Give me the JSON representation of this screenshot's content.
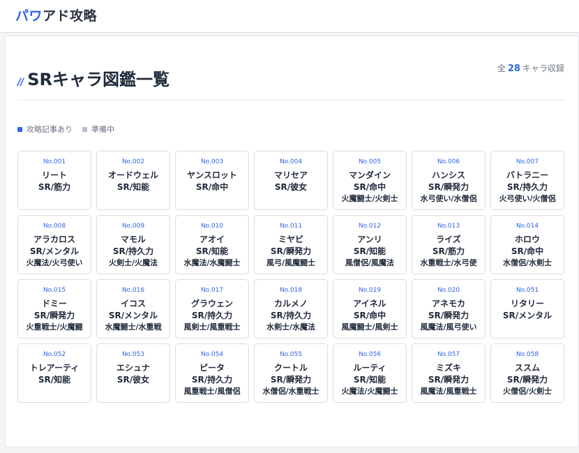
{
  "header": {
    "logo_accent": "パワ",
    "logo_rest": "アド攻略"
  },
  "page": {
    "title_slashes": "//",
    "title": "SRキャラ図鑑一覧",
    "count_prefix": "全",
    "count_value": "28",
    "count_suffix": "キャラ収録"
  },
  "legend": [
    {
      "label": "攻略記事あり",
      "color": "#2f63e8"
    },
    {
      "label": "準備中",
      "color": "#b9c0ca"
    }
  ],
  "cards": [
    {
      "no": "No.001",
      "name": "リート",
      "type": "SR/筋力",
      "job": ""
    },
    {
      "no": "No.002",
      "name": "オードウェル",
      "type": "SR/知能",
      "job": ""
    },
    {
      "no": "No.003",
      "name": "ヤンスロット",
      "type": "SR/命中",
      "job": ""
    },
    {
      "no": "No.004",
      "name": "マリセア",
      "type": "SR/彼女",
      "job": ""
    },
    {
      "no": "No.005",
      "name": "マンダイン",
      "type": "SR/命中",
      "job": "火魔闘士/火剣士"
    },
    {
      "no": "No.006",
      "name": "ハンシス",
      "type": "SR/瞬発力",
      "job": "水弓使い/水僧侶"
    },
    {
      "no": "No.007",
      "name": "バトラニー",
      "type": "SR/持久力",
      "job": "火弓使い/火僧侶"
    },
    {
      "no": "No.008",
      "name": "アラカロス",
      "type": "SR/メンタル",
      "job": "火魔法/火弓使い"
    },
    {
      "no": "No.009",
      "name": "マモル",
      "type": "SR/持久力",
      "job": "火剣士/火魔法"
    },
    {
      "no": "No.010",
      "name": "アオイ",
      "type": "SR/知能",
      "job": "水魔法/水魔闘士"
    },
    {
      "no": "No.011",
      "name": "ミヤビ",
      "type": "SR/瞬発力",
      "job": "風弓/風魔闘士"
    },
    {
      "no": "No.012",
      "name": "アンリ",
      "type": "SR/知能",
      "job": "風僧侶/風魔法"
    },
    {
      "no": "No.013",
      "name": "ライズ",
      "type": "SR/筋力",
      "job": "水重戦士/水弓使"
    },
    {
      "no": "No.014",
      "name": "ホロウ",
      "type": "SR/命中",
      "job": "水僧侶/水剣士"
    },
    {
      "no": "No.015",
      "name": "ドミー",
      "type": "SR/瞬発力",
      "job": "火重戦士/火魔闘"
    },
    {
      "no": "No.016",
      "name": "イコス",
      "type": "SR/メンタル",
      "job": "水魔闘士/水重戦"
    },
    {
      "no": "No.017",
      "name": "グラウェン",
      "type": "SR/持久力",
      "job": "風剣士/風重戦士"
    },
    {
      "no": "No.018",
      "name": "カルメノ",
      "type": "SR/持久力",
      "job": "水剣士/水魔法"
    },
    {
      "no": "No.019",
      "name": "アイネル",
      "type": "SR/命中",
      "job": "風魔闘士/風剣士"
    },
    {
      "no": "No.020",
      "name": "アネモカ",
      "type": "SR/瞬発力",
      "job": "風魔法/風弓使い"
    },
    {
      "no": "No.051",
      "name": "リタリー",
      "type": "SR/メンタル",
      "job": ""
    },
    {
      "no": "No.052",
      "name": "トレアーティ",
      "type": "SR/知能",
      "job": ""
    },
    {
      "no": "No.053",
      "name": "エシュナ",
      "type": "SR/彼女",
      "job": ""
    },
    {
      "no": "No.054",
      "name": "ピータ",
      "type": "SR/持久力",
      "job": "風重戦士/風僧侶"
    },
    {
      "no": "No.055",
      "name": "クートル",
      "type": "SR/瞬発力",
      "job": "水僧侶/水重戦士"
    },
    {
      "no": "No.056",
      "name": "ルーティ",
      "type": "SR/知能",
      "job": "火魔法/火魔闘士"
    },
    {
      "no": "No.057",
      "name": "ミズキ",
      "type": "SR/瞬発力",
      "job": "風魔法/風重戦士"
    },
    {
      "no": "No.058",
      "name": "ススム",
      "type": "SR/瞬発力",
      "job": "火僧侶/火剣士"
    }
  ]
}
